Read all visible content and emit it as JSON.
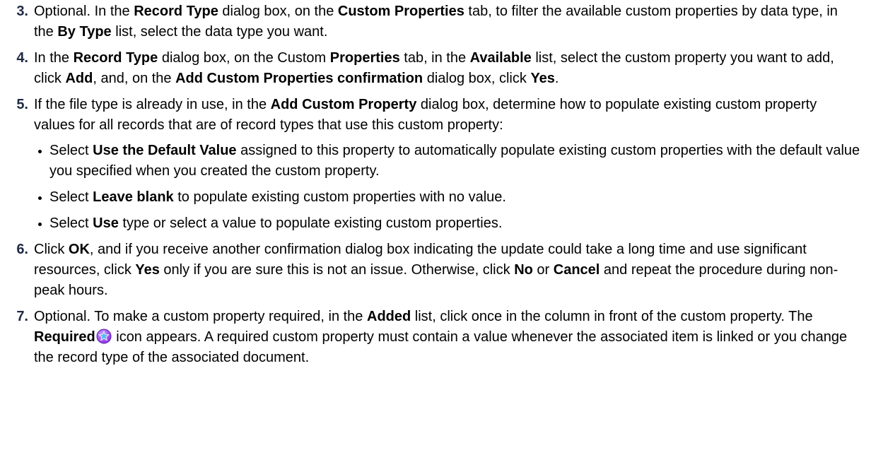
{
  "steps": [
    {
      "num": "3.",
      "parts": [
        {
          "t": "Optional. In the "
        },
        {
          "t": "Record Type",
          "b": true
        },
        {
          "t": " dialog box, on the "
        },
        {
          "t": "Custom Properties",
          "b": true
        },
        {
          "t": " tab, to filter the available custom properties by data type, in the "
        },
        {
          "t": "By Type",
          "b": true
        },
        {
          "t": " list, select the data type you want."
        }
      ]
    },
    {
      "num": "4.",
      "parts": [
        {
          "t": "In the "
        },
        {
          "t": "Record Type",
          "b": true
        },
        {
          "t": " dialog box, on the Custom "
        },
        {
          "t": "Properties",
          "b": true
        },
        {
          "t": " tab, in the "
        },
        {
          "t": "Available",
          "b": true
        },
        {
          "t": " list, select the custom property you want to add, click "
        },
        {
          "t": "Add",
          "b": true
        },
        {
          "t": ", and, on the "
        },
        {
          "t": "Add Custom Properties confirmation",
          "b": true
        },
        {
          "t": " dialog box, click "
        },
        {
          "t": "Yes",
          "b": true
        },
        {
          "t": "."
        }
      ]
    },
    {
      "num": "5.",
      "parts": [
        {
          "t": "If the file type is already in use, in the "
        },
        {
          "t": "Add Custom Property",
          "b": true
        },
        {
          "t": " dialog box, determine how to populate existing custom property values for all records that are of record types that use this custom property:"
        }
      ],
      "bullets": [
        [
          {
            "t": "Select "
          },
          {
            "t": "Use the Default Value",
            "b": true
          },
          {
            "t": " assigned to this property to automatically populate existing custom properties with the default value you specified when you created the custom property."
          }
        ],
        [
          {
            "t": "Select "
          },
          {
            "t": "Leave blank",
            "b": true
          },
          {
            "t": " to populate existing custom properties with no value."
          }
        ],
        [
          {
            "t": "Select "
          },
          {
            "t": "Use",
            "b": true
          },
          {
            "t": " type or select a value to populate existing custom properties."
          }
        ]
      ]
    },
    {
      "num": "6.",
      "parts": [
        {
          "t": "Click "
        },
        {
          "t": "OK",
          "b": true
        },
        {
          "t": ", and if you receive another confirmation dialog box indicating the update could take a long time and use significant resources, click "
        },
        {
          "t": "Yes",
          "b": true
        },
        {
          "t": " only if you are sure this is not an issue. Otherwise, click "
        },
        {
          "t": "No",
          "b": true
        },
        {
          "t": " or "
        },
        {
          "t": "Cancel",
          "b": true
        },
        {
          "t": " and repeat the procedure during non-peak hours."
        }
      ]
    },
    {
      "num": "7.",
      "parts": [
        {
          "t": "Optional. To make a custom property required, in the "
        },
        {
          "t": "Added",
          "b": true
        },
        {
          "t": " list, click once in the column in front of the custom property. The "
        },
        {
          "t": "Required",
          "b": true
        },
        {
          "icon": "required-star-icon"
        },
        {
          "t": " icon appears. A required custom property must contain a value whenever the associated item is linked or you change the record type of the associated document."
        }
      ]
    }
  ],
  "colors": {
    "step_number": "#1f2a44",
    "required_icon_outer": "#8a2be2",
    "required_icon_inner": "#5bb8f0"
  }
}
